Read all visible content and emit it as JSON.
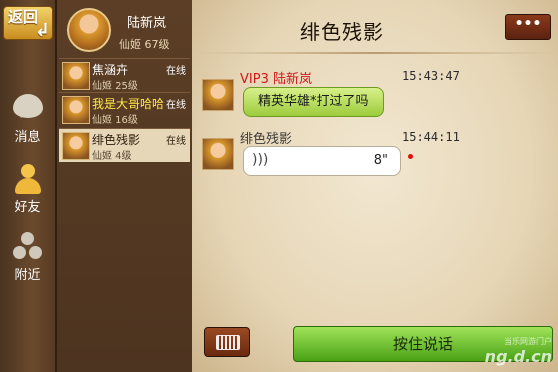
{
  "nav": {
    "back_label": "返回",
    "items": [
      {
        "label": "消息",
        "icon": "message-bubble-icon"
      },
      {
        "label": "好友",
        "icon": "person-icon"
      },
      {
        "label": "附近",
        "icon": "nearby-people-icon"
      }
    ]
  },
  "me": {
    "name": "陆新岚",
    "sub": "仙姬  67级"
  },
  "friends": [
    {
      "name": "焦涵卉",
      "status": "在线",
      "sub": "仙姬  25级",
      "selected": false
    },
    {
      "name": "我是大哥哈哈",
      "status": "在线",
      "sub": "仙姬  16级",
      "selected": false
    },
    {
      "name": "绯色残影",
      "status": "在线",
      "sub": "仙姬  4级",
      "selected": true
    }
  ],
  "chat": {
    "title": "绯色残影",
    "more_label": "•••",
    "messages": [
      {
        "sender": "VIP3  陆新岚",
        "time": "15:43:47",
        "text": "精英华雄*打过了吗"
      },
      {
        "sender": "绯色残影",
        "time": "15:44:11",
        "voice_duration": "8\""
      }
    ],
    "talk_button": "按住说话"
  },
  "watermark": {
    "main": "ng.d.cn",
    "sub": "当乐网游门户"
  },
  "colors": {
    "vip_name": "#d01818",
    "voice_unread_dot": "#e01010",
    "talk_button": "#6cc02c"
  }
}
